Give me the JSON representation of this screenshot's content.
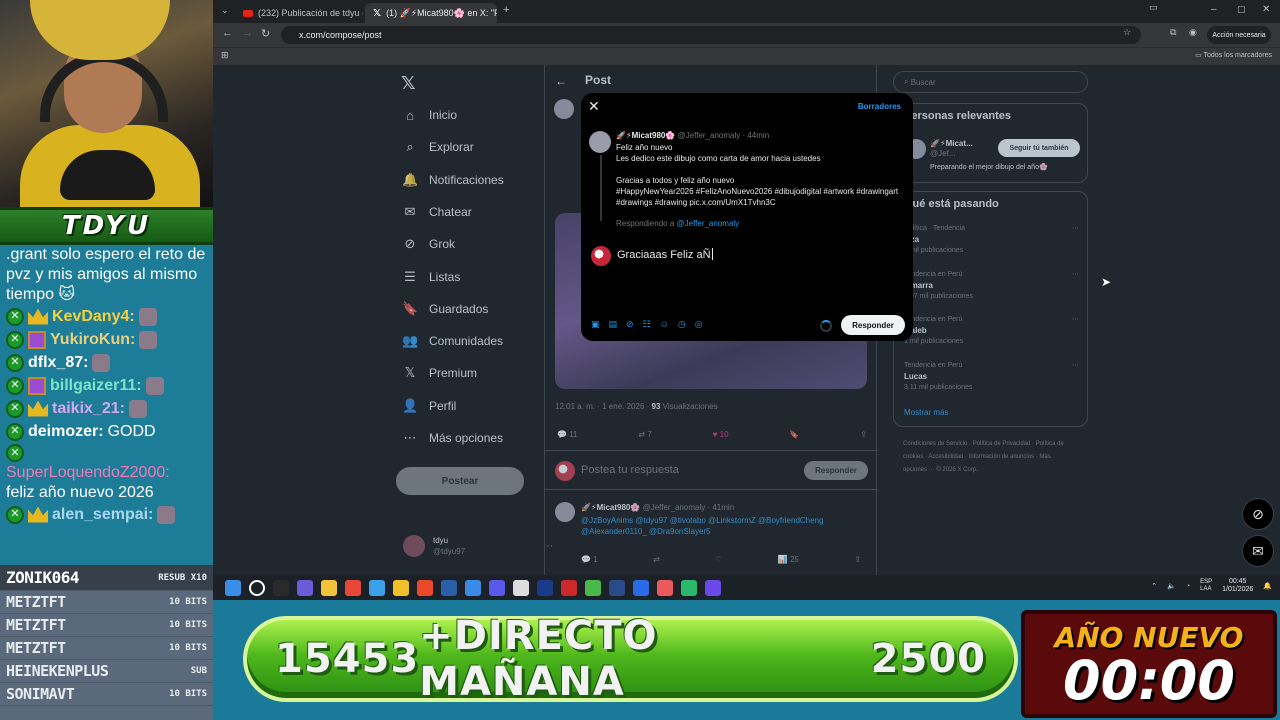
{
  "stream": {
    "streamer_name": "TDYU",
    "chat": [
      {
        "type": "plain",
        "text": ".grant solo espero el reto de pvz y mis amigos al mismo tiempo 🐱"
      },
      {
        "type": "msg",
        "user": "KevDany4:",
        "color": "#f4d03f",
        "badges": [
          "x",
          "crown"
        ],
        "text": "",
        "emote": true
      },
      {
        "type": "msg",
        "user": "YukiroKun:",
        "color": "#e8d080",
        "badges": [
          "x",
          "gift"
        ],
        "text": "",
        "emote": true
      },
      {
        "type": "msg",
        "user": "dflx_87:",
        "color": "#ffffff",
        "badges": [
          "x"
        ],
        "text": "",
        "emote": true
      },
      {
        "type": "msg",
        "user": "billgaizer11:",
        "color": "#7ae6c8",
        "badges": [
          "x",
          "gift"
        ],
        "text": "",
        "emote": true
      },
      {
        "type": "msg",
        "user": "taikix_21:",
        "color": "#d7a6f0",
        "badges": [
          "x",
          "crown"
        ],
        "text": "",
        "emote": true
      },
      {
        "type": "msg",
        "user": "deimozer:",
        "color": "#ffffff",
        "badges": [
          "x"
        ],
        "text": "GODD",
        "emote": false
      },
      {
        "type": "msg",
        "user": "SuperLoquendoZ2000:",
        "color": "#f07ab8",
        "badges": [
          "x"
        ],
        "text": "feliz año nuevo 2026",
        "emote": false
      },
      {
        "type": "msg",
        "user": "alen_sempai:",
        "color": "#a8d8f0",
        "badges": [
          "x",
          "crown"
        ],
        "text": "",
        "emote": true
      }
    ],
    "subs": [
      {
        "name": "ZONIK064",
        "badge": "RESUB X10"
      },
      {
        "name": "METZTFT",
        "badge": "10 BITS"
      },
      {
        "name": "METZTFT",
        "badge": "10 BITS"
      },
      {
        "name": "METZTFT",
        "badge": "10 BITS"
      },
      {
        "name": "HEINEKENPLUS",
        "badge": "SUB"
      },
      {
        "name": "SONIMAVT",
        "badge": "10 BITS"
      }
    ],
    "goal": {
      "count": "15453",
      "label": "+DIRECTO MAÑANA",
      "target": "2500"
    },
    "countdown": {
      "title": "AÑO NUEVO",
      "time": "00:00"
    }
  },
  "browser": {
    "tabs": [
      {
        "label": "(232) Publicación de tdyu - You",
        "icon": "youtube-icon"
      },
      {
        "label": "(1) 🚀⚡Micat980🌸 en X: \"Fe",
        "icon": "x-icon"
      }
    ],
    "url": "x.com/compose/post",
    "account_button": "Acción necesaria",
    "bookmarks_label": "Todos los marcadores"
  },
  "xnav": {
    "items": [
      {
        "label": "Inicio",
        "icon": "home-icon",
        "glyph": "⌂"
      },
      {
        "label": "Explorar",
        "icon": "search-icon",
        "glyph": "⌕"
      },
      {
        "label": "Notificaciones",
        "icon": "bell-icon",
        "glyph": "🔔"
      },
      {
        "label": "Chatear",
        "icon": "mail-icon",
        "glyph": "✉"
      },
      {
        "label": "Grok",
        "icon": "grok-icon",
        "glyph": "⊘"
      },
      {
        "label": "Listas",
        "icon": "list-icon",
        "glyph": "☰"
      },
      {
        "label": "Guardados",
        "icon": "bookmark-icon",
        "glyph": "🔖"
      },
      {
        "label": "Comunidades",
        "icon": "people-icon",
        "glyph": "👥"
      },
      {
        "label": "Premium",
        "icon": "x-premium-icon",
        "glyph": "𝕏"
      },
      {
        "label": "Perfil",
        "icon": "person-icon",
        "glyph": "👤"
      },
      {
        "label": "Más opciones",
        "icon": "more-icon",
        "glyph": "⋯"
      }
    ],
    "post_button": "Postear",
    "me_name": "tdyu",
    "me_handle": "@tdyu97"
  },
  "timeline": {
    "header": "Post",
    "meta": "12:01 a. m. · 1 ene. 2026 · ",
    "views": "93",
    "views_label": " Visualizaciones",
    "actions": {
      "replies": "11",
      "reposts": "7",
      "likes": "10"
    },
    "reply_placeholder": "Postea tu respuesta",
    "reply_button": "Responder",
    "reply2_author": "🚀⚡Micat980🌸",
    "reply2_handle": "@Jeffer_anomaly · 41min",
    "reply2_text": "@JzBoyAnims @tdyu97 @tivotabo @LinkstormZ @BoyfriendCheng @Alexander0110_ @Dra9onSlayer5",
    "reply2_actions": {
      "replies": "1",
      "likes": "25"
    }
  },
  "sidebar": {
    "search_placeholder": "Buscar",
    "relevant_title": "Personas relevantes",
    "relevant_name": "🚀⚡Micat...",
    "relevant_handle": "@Jef...",
    "follow_button": "Seguir tú también",
    "relevant_bio": "Preparando el mejor dibujo del año🌸",
    "trending_title": "Qué está pasando",
    "trends": [
      {
        "context": "Política · Tendencia",
        "name": "...za",
        "count": "6 mil publicaciones"
      },
      {
        "context": "Tendencia en Perú",
        "name": "...marra",
        "count": "1.97 mil publicaciones"
      },
      {
        "context": "Tendencia en Perú",
        "name": "...aleb",
        "count": "1 mil publicaciones"
      },
      {
        "context": "Tendencia en Perú",
        "name": "Lucas",
        "count": "3.11 mil publicaciones"
      }
    ],
    "show_more": "Mostrar más",
    "footer": "Condiciones de Servicio · Política de Privacidad · Política de cookies · Accesibilidad · Información de anuncios · Más opciones ··· © 2026 X Corp."
  },
  "modal": {
    "close_label": "✕",
    "drafts": "Borradores",
    "author": "🚀⚡Micat980🌸",
    "handle": "@Jeffer_anomaly · 44min",
    "body": "Feliz año nuevo\nLes dedico este dibujo como carta de amor hacia ustedes\n\nGracias a todos y feliz año nuevo\n#HappyNewYear2026 #FelizAnoNuevo2026 #dibujodigital #artwork #drawingart #drawings #drawing pic.x.com/UmX1Tvhn3C",
    "replying_to": "Respondiendo a ",
    "replying_handle": "@Jeffer_anomaly",
    "draft_text": "Graciaaas Feliz aÑ",
    "reply_button": "Responder",
    "toolbar_icons": [
      "image-icon",
      "gif-icon",
      "grok-icon",
      "poll-icon",
      "emoji-icon",
      "schedule-icon",
      "location-icon"
    ]
  },
  "tray": {
    "lang": "ESP\nLAA",
    "time": "00:45",
    "date": "1/01/2026"
  }
}
